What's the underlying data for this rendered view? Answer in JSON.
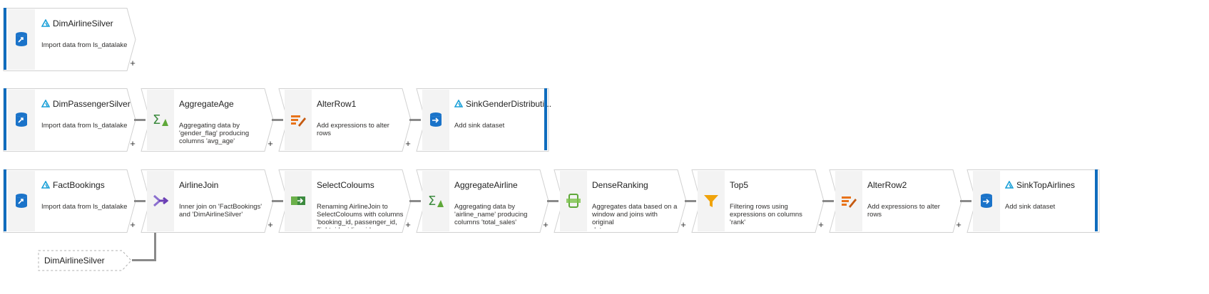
{
  "flows": [
    {
      "nodes": [
        {
          "title": "DimAirlineSilver",
          "desc": "Import data from ls_datalake",
          "type": "source"
        }
      ]
    },
    {
      "nodes": [
        {
          "title": "DimPassengerSilver",
          "desc": "Import data from ls_datalake",
          "type": "source"
        },
        {
          "title": "AggregateAge",
          "desc": "Aggregating data by\n'gender_flag' producing\ncolumns 'avg_age'",
          "type": "aggregate"
        },
        {
          "title": "AlterRow1",
          "desc": "Add expressions to alter rows",
          "type": "alterrow"
        },
        {
          "title": "SinkGenderDistributi...",
          "desc": "Add sink dataset",
          "type": "sink"
        }
      ]
    },
    {
      "nodes": [
        {
          "title": "FactBookings",
          "desc": "Import data from ls_datalake",
          "type": "source"
        },
        {
          "title": "AirlineJoin",
          "desc": "Inner join on 'FactBookings'\nand 'DimAirlineSilver'",
          "type": "join"
        },
        {
          "title": "SelectColoums",
          "desc": "Renaming AirlineJoin to\nSelectColoums with columns\n'booking_id, passenger_id,\nflight_id, airline_id,",
          "type": "select"
        },
        {
          "title": "AggregateAirline",
          "desc": "Aggregating data by\n'airline_name' producing\ncolumns 'total_sales'",
          "type": "aggregate"
        },
        {
          "title": "DenseRanking",
          "desc": "Aggregates data based on a\nwindow and joins with original\ndata",
          "type": "window"
        },
        {
          "title": "Top5",
          "desc": "Filtering rows using\nexpressions on columns 'rank'",
          "type": "filter"
        },
        {
          "title": "AlterRow2",
          "desc": "Add expressions to alter rows",
          "type": "alterrow"
        },
        {
          "title": "SinkTopAirlines",
          "desc": "Add sink dataset",
          "type": "sink"
        }
      ]
    }
  ],
  "reference_stream": {
    "label": "DimAirlineSilver"
  },
  "add_label": "+",
  "colors": {
    "accent": "#0f6cbd",
    "connector": "#8a8a8a",
    "border": "#d1d1d1",
    "icon_bg": "#f3f3f3"
  }
}
